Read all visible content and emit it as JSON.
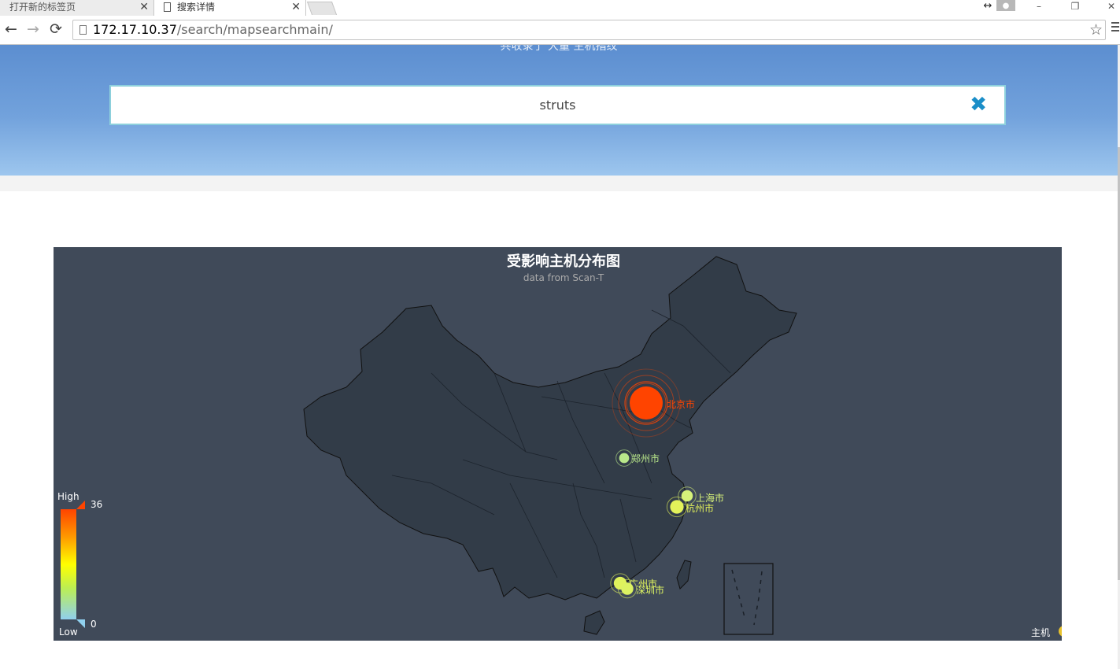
{
  "browser": {
    "tabs": [
      {
        "title": "打开新的标签页",
        "active": false
      },
      {
        "title": "搜索详情",
        "active": true
      }
    ],
    "close_glyph": "✕",
    "url_host": "172.17.10.37",
    "url_path": "/search/mapsearchmain/",
    "icons": [
      "back-arrow-icon",
      "forward-arrow-icon",
      "reload-icon",
      "page-icon",
      "bookmark-star-icon",
      "menu-icon",
      "user-icon",
      "minimize-icon",
      "maximize-icon",
      "close-icon"
    ]
  },
  "hero": {
    "caption": "共收录了 大量 主机指纹",
    "search_value": "struts",
    "clear_icon": "clear-x-icon",
    "accent": "#1b8ec8"
  },
  "map": {
    "title": "受影响主机分布图",
    "subtitle": "data from Scan-T",
    "background": "#404a59",
    "visual_map": {
      "high_label": "High",
      "low_label": "Low",
      "max": "36",
      "min": "0"
    },
    "legend": {
      "label": "主机",
      "color": "#e8c22d"
    },
    "cities": [
      {
        "name": "北京市",
        "value": 36,
        "color": "#ff4400"
      },
      {
        "name": "郑州市",
        "value": 3,
        "color": "#b9e88a"
      },
      {
        "name": "上海市",
        "value": 5,
        "color": "#d6f27a"
      },
      {
        "name": "杭州市",
        "value": 8,
        "color": "#e3f25a"
      },
      {
        "name": "广州市",
        "value": 7,
        "color": "#e0f25c"
      },
      {
        "name": "深圳市",
        "value": 6,
        "color": "#dcf262"
      }
    ]
  }
}
